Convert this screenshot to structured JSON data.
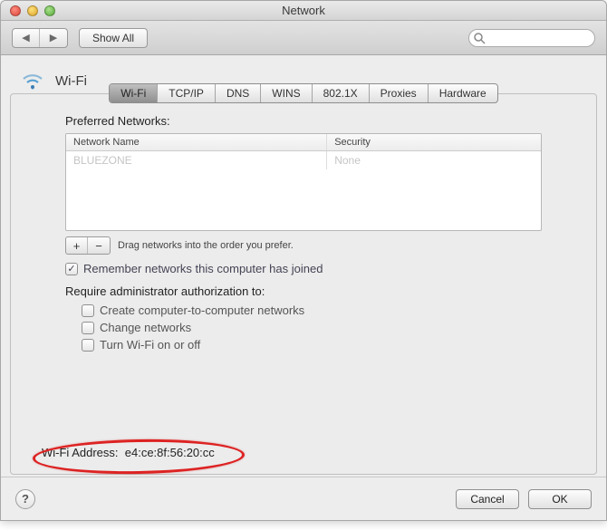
{
  "window": {
    "title": "Network"
  },
  "toolbar": {
    "back": "◀",
    "forward": "▶",
    "show_all": "Show All",
    "search_placeholder": ""
  },
  "header": {
    "title": "Wi-Fi"
  },
  "tabs": [
    "Wi-Fi",
    "TCP/IP",
    "DNS",
    "WINS",
    "802.1X",
    "Proxies",
    "Hardware"
  ],
  "active_tab": 0,
  "preferred": {
    "label": "Preferred Networks:",
    "cols": {
      "name": "Network Name",
      "security": "Security"
    },
    "rows": [
      {
        "name": "BLUEZONE",
        "security": "None"
      }
    ],
    "hint": "Drag networks into the order you prefer."
  },
  "remember": {
    "checked": true,
    "label": "Remember networks this computer has joined"
  },
  "require": {
    "label": "Require administrator authorization to:",
    "items": [
      {
        "checked": false,
        "label": "Create computer-to-computer networks"
      },
      {
        "checked": false,
        "label": "Change networks"
      },
      {
        "checked": false,
        "label": "Turn Wi-Fi on or off"
      }
    ]
  },
  "address": {
    "label": "Wi-Fi Address:",
    "value": "e4:ce:8f:56:20:cc"
  },
  "footer": {
    "cancel": "Cancel",
    "ok": "OK",
    "help": "?"
  },
  "pm": {
    "plus": "+",
    "minus": "−"
  }
}
